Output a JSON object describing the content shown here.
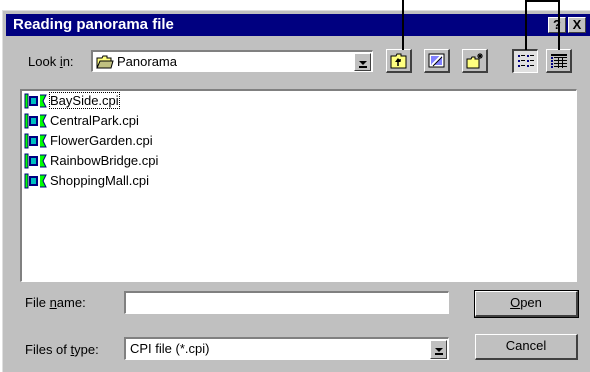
{
  "window": {
    "title": "Reading panorama file",
    "help_label": "?",
    "close_label": "X"
  },
  "look_in": {
    "label_pre": "Look ",
    "label_key": "i",
    "label_post": "n:",
    "value": "Panorama",
    "folder_icon": "folder-icon"
  },
  "toolbar": {
    "icons": [
      "up-one-level-icon",
      "desktop-icon",
      "create-new-folder-icon",
      "list-view-icon",
      "details-view-icon"
    ]
  },
  "files": [
    {
      "name": "BaySide.cpi",
      "icon": "cpi-file-icon",
      "focused": true
    },
    {
      "name": "CentralPark.cpi",
      "icon": "cpi-file-icon"
    },
    {
      "name": "FlowerGarden.cpi",
      "icon": "cpi-file-icon"
    },
    {
      "name": "RainbowBridge.cpi",
      "icon": "cpi-file-icon"
    },
    {
      "name": "ShoppingMall.cpi",
      "icon": "cpi-file-icon"
    }
  ],
  "file_name": {
    "label_pre": "File ",
    "label_key": "n",
    "label_post": "ame:",
    "value": ""
  },
  "file_type": {
    "label_pre": "Files of ",
    "label_key": "t",
    "label_post": "ype:",
    "value": "CPI file (*.cpi)"
  },
  "buttons": {
    "open_key": "O",
    "open_rest": "pen",
    "cancel": "Cancel"
  }
}
